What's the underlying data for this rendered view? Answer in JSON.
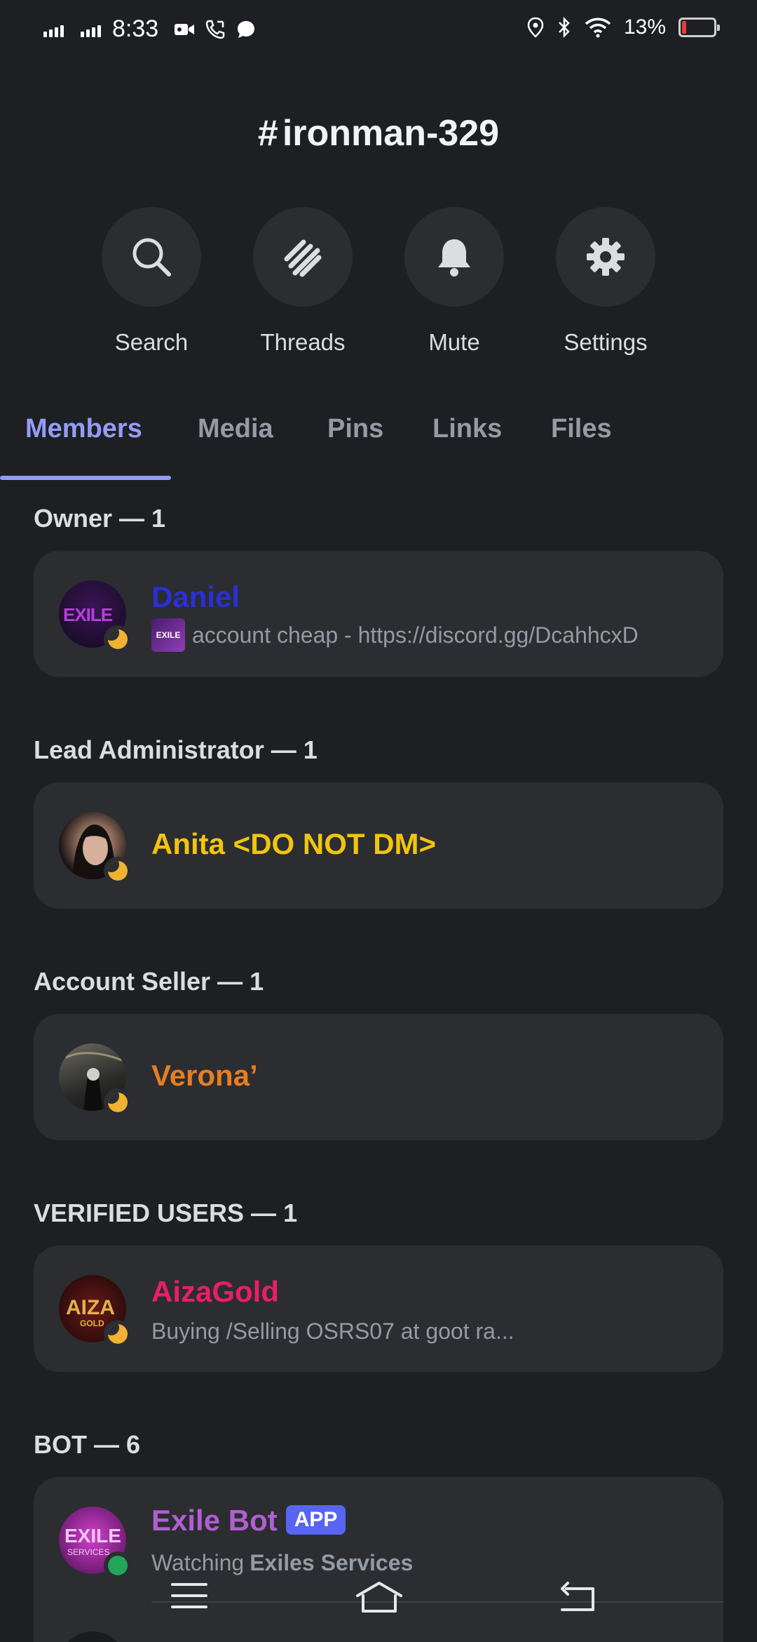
{
  "status_bar": {
    "time": "8:33",
    "battery_pct": "13%",
    "battery_level": 0.13,
    "battery_color": "#e63b3b",
    "left_icons": [
      "signal-icon",
      "signal-icon",
      "video-call-icon",
      "phone-call-icon",
      "chat-bubble-icon"
    ],
    "right_icons": [
      "location-icon",
      "bluetooth-icon",
      "wifi-icon"
    ]
  },
  "channel": {
    "hash": "#",
    "name": "ironman-329"
  },
  "actions": [
    {
      "label": "Search",
      "icon": "search-icon"
    },
    {
      "label": "Threads",
      "icon": "threads-icon"
    },
    {
      "label": "Mute",
      "icon": "bell-icon"
    },
    {
      "label": "Settings",
      "icon": "gear-icon"
    }
  ],
  "tabs": [
    {
      "label": "Members",
      "active": true
    },
    {
      "label": "Media",
      "active": false
    },
    {
      "label": "Pins",
      "active": false
    },
    {
      "label": "Links",
      "active": false
    },
    {
      "label": "Files",
      "active": false
    }
  ],
  "accent_color": "#949cf7",
  "sections": [
    {
      "heading": "Owner — 1",
      "members": [
        {
          "name": "Daniel",
          "color": "#2b2fd6",
          "status": "idle",
          "subtitle": "account cheap - https://discord.gg/DcahhcxD",
          "subtitle_icon": "EXILE"
        }
      ]
    },
    {
      "heading": "Lead Administrator — 1",
      "members": [
        {
          "name": "Anita <DO NOT DM>",
          "color": "#f1c40f",
          "status": "idle"
        }
      ]
    },
    {
      "heading": "Account Seller — 1",
      "members": [
        {
          "name": "Verona’",
          "color": "#e67e22",
          "status": "idle"
        }
      ]
    },
    {
      "heading": "VERIFIED USERS — 1",
      "members": [
        {
          "name": "AizaGold",
          "color": "#e91e63",
          "status": "idle",
          "subtitle": "Buying /Selling OSRS07 at goot ra..."
        }
      ]
    },
    {
      "heading": "BOT — 6",
      "members": [
        {
          "name": "Exile Bot",
          "color": "#b05fd0",
          "status": "online",
          "badge": "APP",
          "subtitle_prefix": "Watching",
          "subtitle_bold": "Exiles Services"
        }
      ]
    }
  ],
  "avatar_texts": {
    "daniel": "EXILE",
    "aiza": "AIZA",
    "aiza_sub": "GOLD",
    "exile_bot": "EXILE",
    "exile_bot_sub": "SERVICES"
  },
  "nav": {
    "icons": [
      "menu-icon",
      "home-icon",
      "back-icon"
    ]
  }
}
